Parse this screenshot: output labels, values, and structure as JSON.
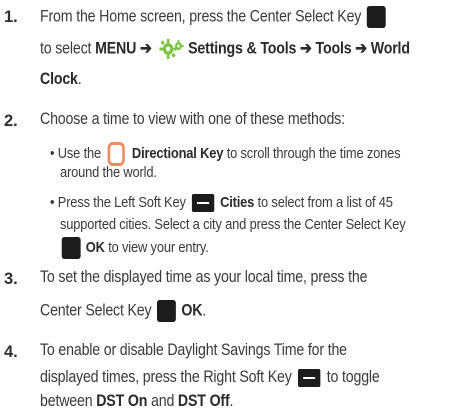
{
  "steps": [
    {
      "number": "1.",
      "lines": [
        [
          "From the Home screen, press the Center Select Key"
        ],
        [
          "to select ",
          "MENU",
          " ➔ ",
          "Settings & Tools",
          " ➔ ",
          "Tools",
          " ➔ ",
          "World"
        ],
        [
          "Clock",
          "."
        ]
      ]
    },
    {
      "number": "2.",
      "lines": [
        [
          "Choose a time to view with one of these methods:"
        ]
      ],
      "bullets": [
        {
          "lines": [
            [
              "• Use the",
              "Directional Key",
              " to scroll through the time zones"
            ],
            [
              "around the world."
            ]
          ]
        },
        {
          "lines": [
            [
              "• Press the Left Soft Key",
              "Cities",
              " to select from a list of 45"
            ],
            [
              "supported cities. Select a city and press the Center Select Key"
            ],
            [
              "OK",
              " to view your entry."
            ]
          ]
        }
      ]
    },
    {
      "number": "3.",
      "lines": [
        [
          "To set the displayed time as your local time, press the"
        ],
        [
          "Center Select Key",
          "OK",
          "."
        ]
      ]
    },
    {
      "number": "4.",
      "lines": [
        [
          "To enable or disable Daylight Savings Time for the"
        ],
        [
          "displayed times, press the Right Soft Key",
          " to toggle"
        ],
        [
          "between ",
          "DST On",
          " and ",
          "DST Off",
          "."
        ]
      ]
    }
  ],
  "icons": {
    "center_select_key": "center-select-key-icon",
    "settings_tools": "settings-gear-icon",
    "directional_key": "directional-key-icon",
    "left_soft_key": "left-soft-key-icon",
    "right_soft_key": "right-soft-key-icon"
  },
  "colors": {
    "text": "#3a3a3a",
    "key": "#1c1c1c",
    "directional_key_outline": "#f08a5d",
    "gear_green": "#7cc242"
  }
}
